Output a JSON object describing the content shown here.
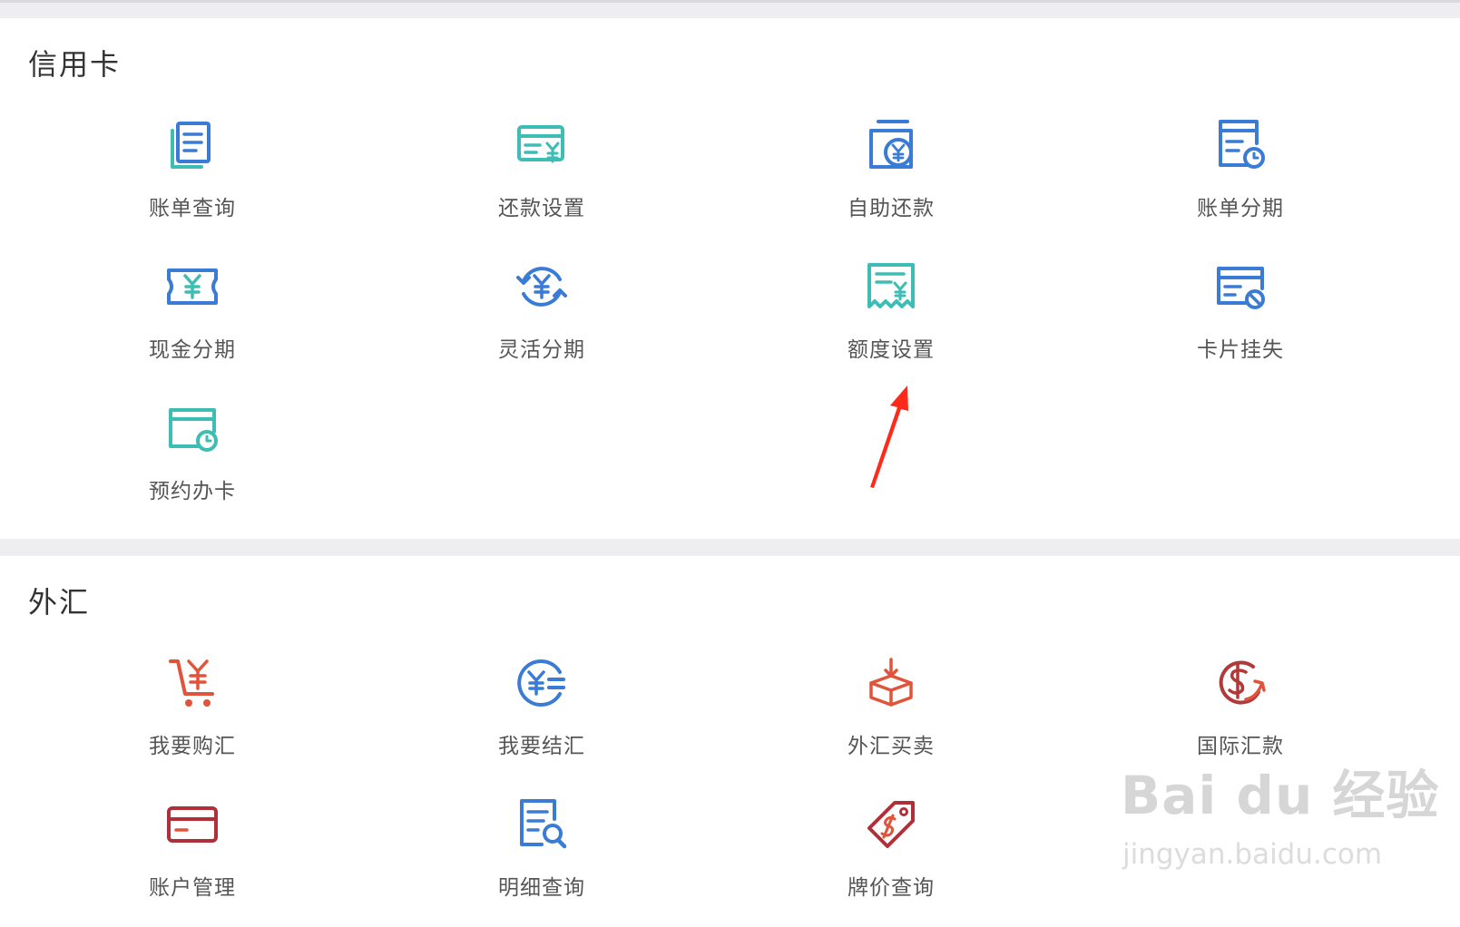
{
  "sections": {
    "credit": {
      "title": "信用卡",
      "items": [
        {
          "label": "账单查询",
          "icon": "bill-document-icon"
        },
        {
          "label": "还款设置",
          "icon": "repayment-settings-icon"
        },
        {
          "label": "自助还款",
          "icon": "self-repay-wallet-icon"
        },
        {
          "label": "账单分期",
          "icon": "bill-installment-clock-icon"
        },
        {
          "label": "现金分期",
          "icon": "cash-ticket-icon"
        },
        {
          "label": "灵活分期",
          "icon": "flexible-cycle-icon"
        },
        {
          "label": "额度设置",
          "icon": "credit-limit-receipt-icon"
        },
        {
          "label": "卡片挂失",
          "icon": "card-lost-block-icon"
        },
        {
          "label": "预约办卡",
          "icon": "card-appointment-icon"
        }
      ]
    },
    "fx": {
      "title": "外汇",
      "items": [
        {
          "label": "我要购汇",
          "icon": "buy-currency-cart-icon"
        },
        {
          "label": "我要结汇",
          "icon": "settle-currency-icon"
        },
        {
          "label": "外汇买卖",
          "icon": "fx-trade-box-icon"
        },
        {
          "label": "国际汇款",
          "icon": "international-remit-dollar-icon"
        },
        {
          "label": "账户管理",
          "icon": "account-card-icon"
        },
        {
          "label": "明细查询",
          "icon": "detail-search-icon"
        },
        {
          "label": "牌价查询",
          "icon": "price-tag-icon"
        }
      ]
    }
  },
  "colors": {
    "blue": "#3a7bd5",
    "teal": "#3dbdb4",
    "orange_red": "#e0543c",
    "dark_red": "#b0303a",
    "annotation_arrow": "#ff2a1a"
  },
  "watermark": {
    "logo": "Bai du 经验",
    "url": "jingyan.baidu.com"
  }
}
